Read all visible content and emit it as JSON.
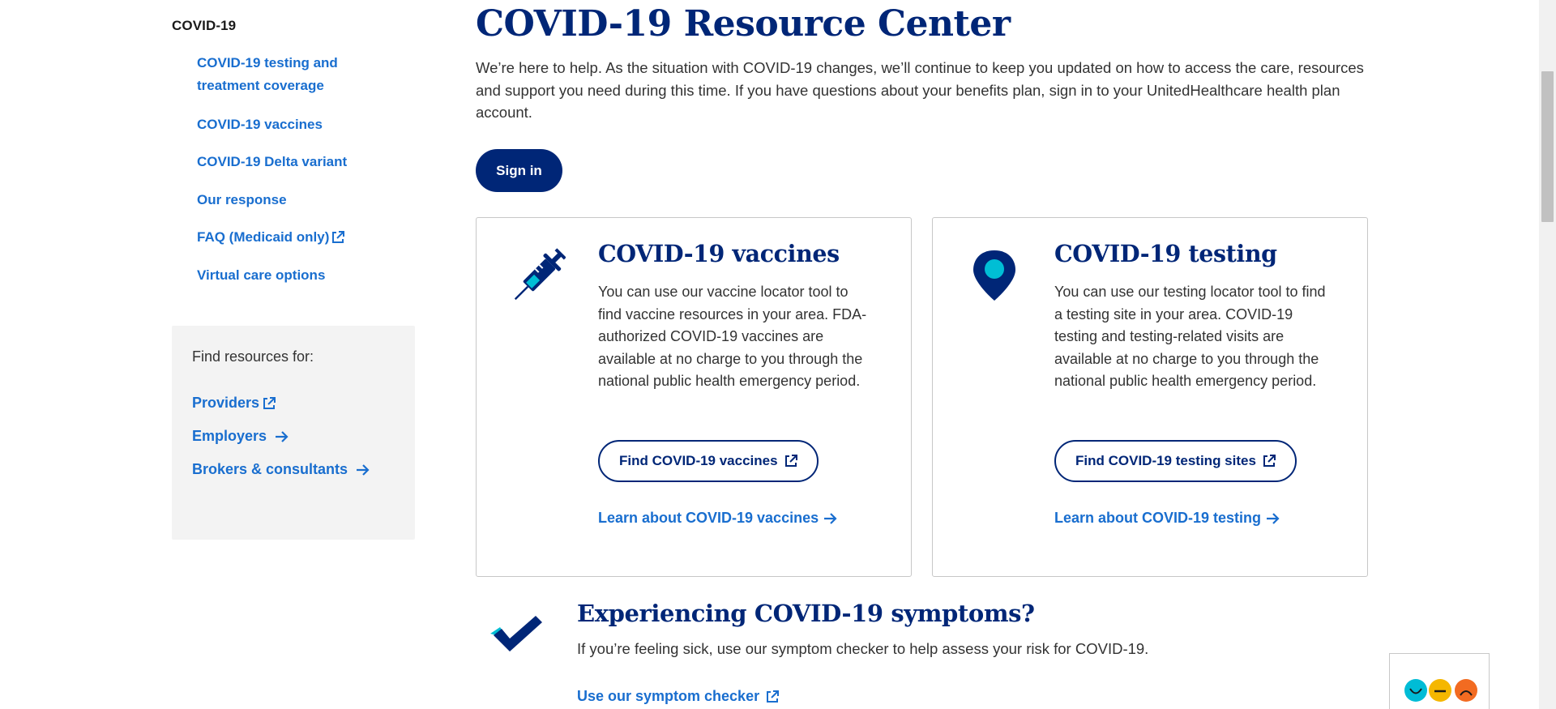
{
  "sidebar": {
    "heading": "COVID-19",
    "nav": [
      {
        "label": "COVID-19 testing and treatment coverage",
        "external": false
      },
      {
        "label": "COVID-19 vaccines",
        "external": false
      },
      {
        "label": "COVID-19 Delta variant",
        "external": false
      },
      {
        "label": "Our response",
        "external": false
      },
      {
        "label": "FAQ (Medicaid only)",
        "external": true
      },
      {
        "label": "Virtual care options",
        "external": false
      }
    ],
    "resources": {
      "title": "Find resources for:",
      "links": [
        {
          "label": "Providers",
          "icon": "external-link-icon"
        },
        {
          "label": "Employers",
          "icon": "arrow-right-icon"
        },
        {
          "label": "Brokers & consultants",
          "icon": "arrow-right-icon"
        }
      ]
    }
  },
  "main": {
    "title": "COVID-19 Resource Center",
    "intro": "We’re here to help. As the situation with COVID-19 changes, we’ll continue to keep you updated on how to access the care, resources and support you need during this time. If you have questions about your benefits plan, sign in to your UnitedHealthcare health plan account.",
    "signin_label": "Sign in",
    "cards": [
      {
        "title": "COVID-19 vaccines",
        "body": "You can use our vaccine locator tool to find vaccine resources in your area. FDA-authorized COVID-19 vaccines are available at no charge to you through the national public health emergency period.",
        "button": "Find COVID-19 vaccines",
        "link": "Learn about COVID-19 vaccines",
        "icon": "syringe-icon"
      },
      {
        "title": "COVID-19 testing",
        "body": "You can use our testing locator tool to find a testing site in your area. COVID-19 testing and testing-related visits are available at no charge to you through the national public health emergency period.",
        "button": "Find COVID-19 testing sites",
        "link": "Learn about COVID-19 testing",
        "icon": "map-pin-icon"
      }
    ],
    "symptoms": {
      "title": "Experiencing COVID-19 symptoms?",
      "body": "If you’re feeling sick, use our symptom checker to help assess your risk for COVID-19.",
      "link": "Use our symptom checker",
      "icon": "checkmark-icon"
    }
  },
  "feedback": {
    "faces": [
      {
        "name": "happy-face-icon",
        "color": "#00BCD6"
      },
      {
        "name": "neutral-face-icon",
        "color": "#F5B700"
      },
      {
        "name": "sad-face-icon",
        "color": "#F26B21"
      }
    ]
  },
  "colors": {
    "brand_navy": "#002677",
    "link_blue": "#196ECF",
    "accent_cyan": "#00BED5"
  }
}
